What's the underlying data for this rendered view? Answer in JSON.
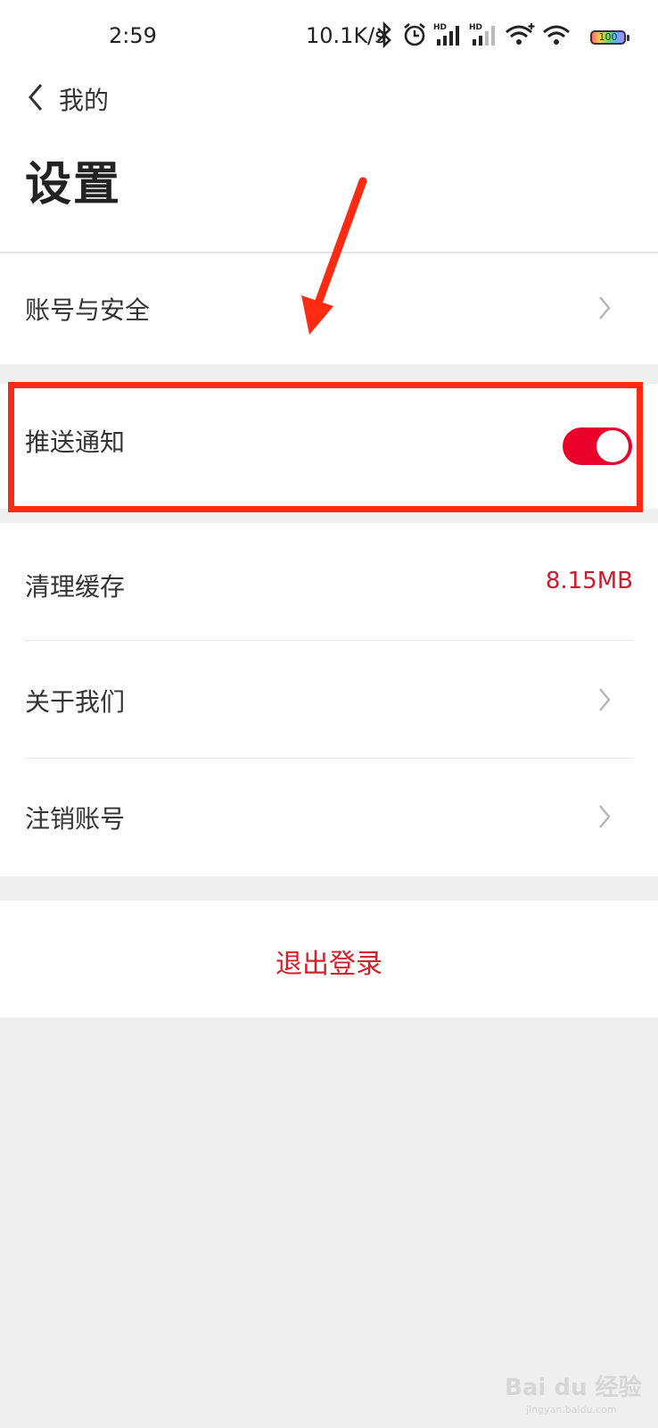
{
  "status_bar": {
    "time": "2:59",
    "net_speed": "10.1K/s",
    "battery_level": "100",
    "icons": [
      "bluetooth-icon",
      "alarm-icon",
      "signal-hd-icon",
      "signal-hd-icon",
      "wifi-plus-icon",
      "wifi-icon",
      "battery-icon"
    ]
  },
  "nav": {
    "back_label": "我的",
    "title": "设置"
  },
  "settings": {
    "account_security": "账号与安全",
    "push_notifications": "推送通知",
    "push_enabled": true,
    "clear_cache": "清理缓存",
    "cache_size": "8.15MB",
    "about_us": "关于我们",
    "deregister_account": "注销账号"
  },
  "logout": "退出登录",
  "watermark": {
    "brand": "Bai du 经验",
    "url": "jingyan.baidu.com"
  },
  "colors": {
    "accent": "#e8002a",
    "value_text": "#cf1b2b",
    "annotation": "#ff2a12"
  }
}
